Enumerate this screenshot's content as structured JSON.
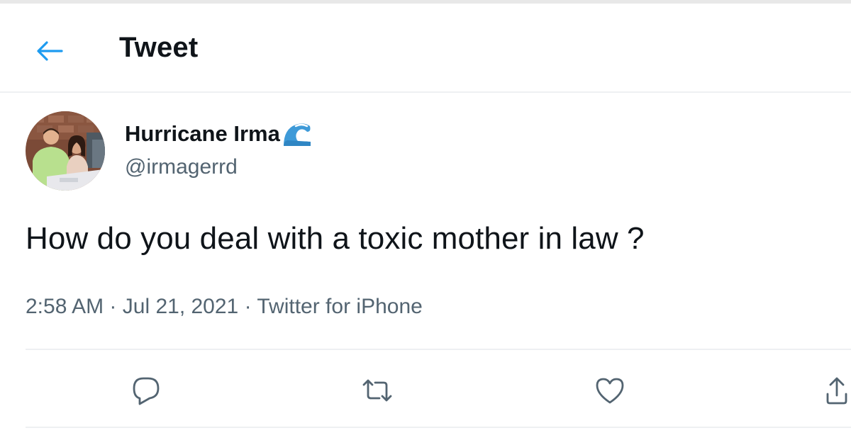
{
  "header": {
    "title": "Tweet",
    "back_icon": "arrow-left-icon"
  },
  "author": {
    "display_name": "Hurricane Irma",
    "name_emoji": "water-wave-emoji",
    "handle": "@irmagerrd"
  },
  "tweet": {
    "text": "How do you deal with a toxic mother in law ?",
    "time": "2:58 AM",
    "separator": "·",
    "date": "Jul 21, 2021",
    "source": "Twitter for iPhone"
  },
  "actions": [
    {
      "icon": "reply-icon"
    },
    {
      "icon": "retweet-icon"
    },
    {
      "icon": "like-icon"
    },
    {
      "icon": "share-icon"
    }
  ],
  "colors": {
    "accent": "#1d9bf0",
    "text_primary": "#0f1419",
    "text_secondary": "#536471",
    "divider": "#eef0f2"
  }
}
